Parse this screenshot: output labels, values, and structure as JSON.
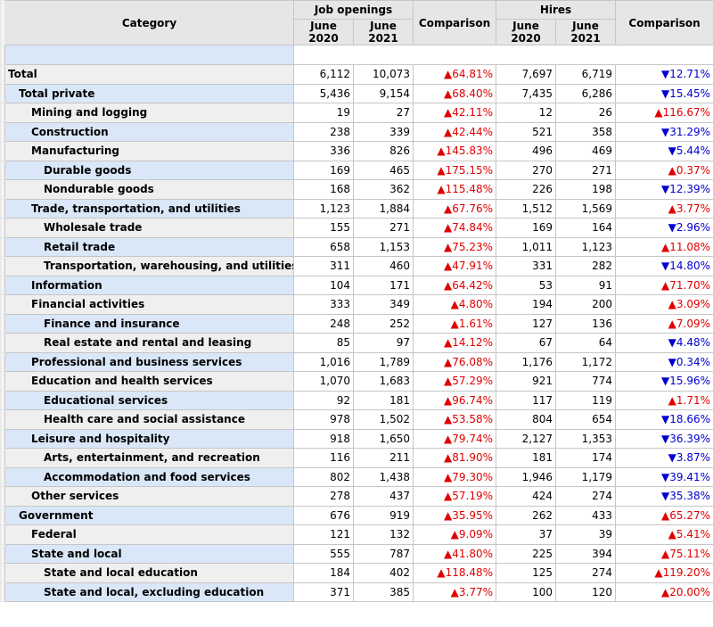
{
  "header": {
    "category": "Category",
    "job_openings": "Job openings",
    "hires": "Hires",
    "comparison": "Comparison",
    "month": "June",
    "year_a": "2020",
    "year_b": "2021"
  },
  "colors": {
    "increase": "#e00000",
    "decrease": "#0000d0",
    "row_blue": "#d9e7f8",
    "row_gray": "#efefef"
  },
  "rows": [
    {
      "category": "Total",
      "level": 0,
      "jo_2020": "6,112",
      "jo_2021": "10,073",
      "jo_cmp": "64.81%",
      "jo_dir": "up",
      "h_2020": "7,697",
      "h_2021": "6,719",
      "h_cmp": "12.71%",
      "h_dir": "down"
    },
    {
      "category": "Total private",
      "level": 1,
      "jo_2020": "5,436",
      "jo_2021": "9,154",
      "jo_cmp": "68.40%",
      "jo_dir": "up",
      "h_2020": "7,435",
      "h_2021": "6,286",
      "h_cmp": "15.45%",
      "h_dir": "down"
    },
    {
      "category": "Mining and logging",
      "level": 2,
      "jo_2020": "19",
      "jo_2021": "27",
      "jo_cmp": "42.11%",
      "jo_dir": "up",
      "h_2020": "12",
      "h_2021": "26",
      "h_cmp": "116.67%",
      "h_dir": "up"
    },
    {
      "category": "Construction",
      "level": 2,
      "jo_2020": "238",
      "jo_2021": "339",
      "jo_cmp": "42.44%",
      "jo_dir": "up",
      "h_2020": "521",
      "h_2021": "358",
      "h_cmp": "31.29%",
      "h_dir": "down"
    },
    {
      "category": "Manufacturing",
      "level": 2,
      "jo_2020": "336",
      "jo_2021": "826",
      "jo_cmp": "145.83%",
      "jo_dir": "up",
      "h_2020": "496",
      "h_2021": "469",
      "h_cmp": "5.44%",
      "h_dir": "down"
    },
    {
      "category": "Durable goods",
      "level": 3,
      "jo_2020": "169",
      "jo_2021": "465",
      "jo_cmp": "175.15%",
      "jo_dir": "up",
      "h_2020": "270",
      "h_2021": "271",
      "h_cmp": "0.37%",
      "h_dir": "up"
    },
    {
      "category": "Nondurable goods",
      "level": 3,
      "jo_2020": "168",
      "jo_2021": "362",
      "jo_cmp": "115.48%",
      "jo_dir": "up",
      "h_2020": "226",
      "h_2021": "198",
      "h_cmp": "12.39%",
      "h_dir": "down"
    },
    {
      "category": "Trade, transportation, and utilities",
      "level": 2,
      "jo_2020": "1,123",
      "jo_2021": "1,884",
      "jo_cmp": "67.76%",
      "jo_dir": "up",
      "h_2020": "1,512",
      "h_2021": "1,569",
      "h_cmp": "3.77%",
      "h_dir": "up"
    },
    {
      "category": "Wholesale trade",
      "level": 3,
      "jo_2020": "155",
      "jo_2021": "271",
      "jo_cmp": "74.84%",
      "jo_dir": "up",
      "h_2020": "169",
      "h_2021": "164",
      "h_cmp": "2.96%",
      "h_dir": "down"
    },
    {
      "category": "Retail trade",
      "level": 3,
      "jo_2020": "658",
      "jo_2021": "1,153",
      "jo_cmp": "75.23%",
      "jo_dir": "up",
      "h_2020": "1,011",
      "h_2021": "1,123",
      "h_cmp": "11.08%",
      "h_dir": "up"
    },
    {
      "category": "Transportation, warehousing, and utilities",
      "level": 3,
      "jo_2020": "311",
      "jo_2021": "460",
      "jo_cmp": "47.91%",
      "jo_dir": "up",
      "h_2020": "331",
      "h_2021": "282",
      "h_cmp": "14.80%",
      "h_dir": "down"
    },
    {
      "category": "Information",
      "level": 2,
      "jo_2020": "104",
      "jo_2021": "171",
      "jo_cmp": "64.42%",
      "jo_dir": "up",
      "h_2020": "53",
      "h_2021": "91",
      "h_cmp": "71.70%",
      "h_dir": "up"
    },
    {
      "category": "Financial activities",
      "level": 2,
      "jo_2020": "333",
      "jo_2021": "349",
      "jo_cmp": "4.80%",
      "jo_dir": "up",
      "h_2020": "194",
      "h_2021": "200",
      "h_cmp": "3.09%",
      "h_dir": "up"
    },
    {
      "category": "Finance and insurance",
      "level": 3,
      "jo_2020": "248",
      "jo_2021": "252",
      "jo_cmp": "1.61%",
      "jo_dir": "up",
      "h_2020": "127",
      "h_2021": "136",
      "h_cmp": "7.09%",
      "h_dir": "up"
    },
    {
      "category": "Real estate and rental and leasing",
      "level": 3,
      "jo_2020": "85",
      "jo_2021": "97",
      "jo_cmp": "14.12%",
      "jo_dir": "up",
      "h_2020": "67",
      "h_2021": "64",
      "h_cmp": "4.48%",
      "h_dir": "down"
    },
    {
      "category": "Professional and business services",
      "level": 2,
      "jo_2020": "1,016",
      "jo_2021": "1,789",
      "jo_cmp": "76.08%",
      "jo_dir": "up",
      "h_2020": "1,176",
      "h_2021": "1,172",
      "h_cmp": "0.34%",
      "h_dir": "down"
    },
    {
      "category": "Education and health services",
      "level": 2,
      "jo_2020": "1,070",
      "jo_2021": "1,683",
      "jo_cmp": "57.29%",
      "jo_dir": "up",
      "h_2020": "921",
      "h_2021": "774",
      "h_cmp": "15.96%",
      "h_dir": "down"
    },
    {
      "category": "Educational services",
      "level": 3,
      "jo_2020": "92",
      "jo_2021": "181",
      "jo_cmp": "96.74%",
      "jo_dir": "up",
      "h_2020": "117",
      "h_2021": "119",
      "h_cmp": "1.71%",
      "h_dir": "up"
    },
    {
      "category": "Health care and social assistance",
      "level": 3,
      "jo_2020": "978",
      "jo_2021": "1,502",
      "jo_cmp": "53.58%",
      "jo_dir": "up",
      "h_2020": "804",
      "h_2021": "654",
      "h_cmp": "18.66%",
      "h_dir": "down"
    },
    {
      "category": "Leisure and hospitality",
      "level": 2,
      "jo_2020": "918",
      "jo_2021": "1,650",
      "jo_cmp": "79.74%",
      "jo_dir": "up",
      "h_2020": "2,127",
      "h_2021": "1,353",
      "h_cmp": "36.39%",
      "h_dir": "down"
    },
    {
      "category": "Arts, entertainment, and recreation",
      "level": 3,
      "jo_2020": "116",
      "jo_2021": "211",
      "jo_cmp": "81.90%",
      "jo_dir": "up",
      "h_2020": "181",
      "h_2021": "174",
      "h_cmp": "3.87%",
      "h_dir": "down"
    },
    {
      "category": "Accommodation and food services",
      "level": 3,
      "jo_2020": "802",
      "jo_2021": "1,438",
      "jo_cmp": "79.30%",
      "jo_dir": "up",
      "h_2020": "1,946",
      "h_2021": "1,179",
      "h_cmp": "39.41%",
      "h_dir": "down"
    },
    {
      "category": "Other services",
      "level": 2,
      "jo_2020": "278",
      "jo_2021": "437",
      "jo_cmp": "57.19%",
      "jo_dir": "up",
      "h_2020": "424",
      "h_2021": "274",
      "h_cmp": "35.38%",
      "h_dir": "down"
    },
    {
      "category": "Government",
      "level": 1,
      "jo_2020": "676",
      "jo_2021": "919",
      "jo_cmp": "35.95%",
      "jo_dir": "up",
      "h_2020": "262",
      "h_2021": "433",
      "h_cmp": "65.27%",
      "h_dir": "up"
    },
    {
      "category": "Federal",
      "level": 2,
      "jo_2020": "121",
      "jo_2021": "132",
      "jo_cmp": "9.09%",
      "jo_dir": "up",
      "h_2020": "37",
      "h_2021": "39",
      "h_cmp": "5.41%",
      "h_dir": "up"
    },
    {
      "category": "State and local",
      "level": 2,
      "jo_2020": "555",
      "jo_2021": "787",
      "jo_cmp": "41.80%",
      "jo_dir": "up",
      "h_2020": "225",
      "h_2021": "394",
      "h_cmp": "75.11%",
      "h_dir": "up"
    },
    {
      "category": "State and local education",
      "level": 3,
      "jo_2020": "184",
      "jo_2021": "402",
      "jo_cmp": "118.48%",
      "jo_dir": "up",
      "h_2020": "125",
      "h_2021": "274",
      "h_cmp": "119.20%",
      "h_dir": "up"
    },
    {
      "category": "State and local, excluding education",
      "level": 3,
      "jo_2020": "371",
      "jo_2021": "385",
      "jo_cmp": "3.77%",
      "jo_dir": "up",
      "h_2020": "100",
      "h_2021": "120",
      "h_cmp": "20.00%",
      "h_dir": "up"
    }
  ]
}
